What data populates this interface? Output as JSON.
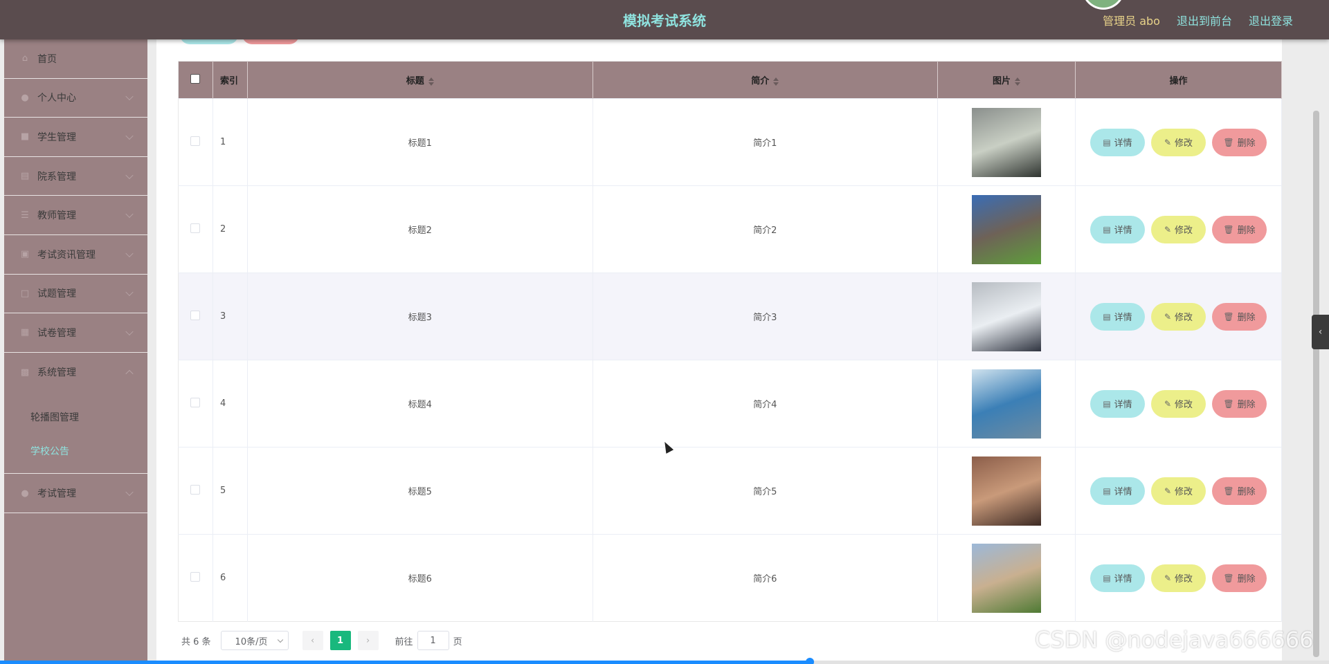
{
  "header": {
    "title": "模拟考试系统",
    "admin_label": "管理员 abo",
    "front_link": "退出到前台",
    "logout_link": "退出登录"
  },
  "sidebar": {
    "items": [
      {
        "label": "首页",
        "icon": "home-icon"
      },
      {
        "label": "个人中心",
        "icon": "user-icon"
      },
      {
        "label": "学生管理",
        "icon": "student-icon"
      },
      {
        "label": "院系管理",
        "icon": "department-icon"
      },
      {
        "label": "教师管理",
        "icon": "teacher-icon"
      },
      {
        "label": "考试资讯管理",
        "icon": "news-icon"
      },
      {
        "label": "试题管理",
        "icon": "question-icon"
      },
      {
        "label": "试卷管理",
        "icon": "paper-icon"
      },
      {
        "label": "系统管理",
        "icon": "system-icon"
      },
      {
        "label": "考试管理",
        "icon": "exam-icon"
      }
    ],
    "system_sub": [
      "轮播图管理",
      "学校公告"
    ]
  },
  "table": {
    "headers": {
      "index": "索引",
      "title": "标题",
      "intro": "简介",
      "image": "图片",
      "actions": "操作"
    },
    "rows": [
      {
        "index": "1",
        "title": "标题1",
        "intro": "简介1",
        "image_colors": [
          "#8a8f8c",
          "#c9cfc4",
          "#2f3430"
        ]
      },
      {
        "index": "2",
        "title": "标题2",
        "intro": "简介2",
        "image_colors": [
          "#3a6db5",
          "#6e6257",
          "#5e9e3b"
        ]
      },
      {
        "index": "3",
        "title": "标题3",
        "intro": "简介3",
        "image_colors": [
          "#b7bcc2",
          "#eaeef2",
          "#2f3440"
        ]
      },
      {
        "index": "4",
        "title": "标题4",
        "intro": "简介4",
        "image_colors": [
          "#cfe2ee",
          "#3b7fb6",
          "#6d8ba1"
        ]
      },
      {
        "index": "5",
        "title": "标题5",
        "intro": "简介5",
        "image_colors": [
          "#8c5e4a",
          "#c99a7a",
          "#3d2a24"
        ]
      },
      {
        "index": "6",
        "title": "标题6",
        "intro": "简介6",
        "image_colors": [
          "#9cb8d8",
          "#c9b090",
          "#4f7a34"
        ]
      }
    ],
    "actions": {
      "detail": "详情",
      "edit": "修改",
      "delete": "删除"
    }
  },
  "pagination": {
    "total": "共 6 条",
    "page_size": "10条/页",
    "current_page": "1",
    "goto_label": "前往",
    "goto_value": "1",
    "page_suffix": "页"
  },
  "watermark": "CSDN @nodejava666666",
  "colors": {
    "header_bg": "#5a4c4e",
    "sidebar_bg": "#9a8183",
    "accent": "#8fe3df",
    "detail_btn": "#abe7e9",
    "edit_btn": "#ecef8a",
    "delete_btn": "#f09a9c",
    "page_active": "#19b87d"
  }
}
